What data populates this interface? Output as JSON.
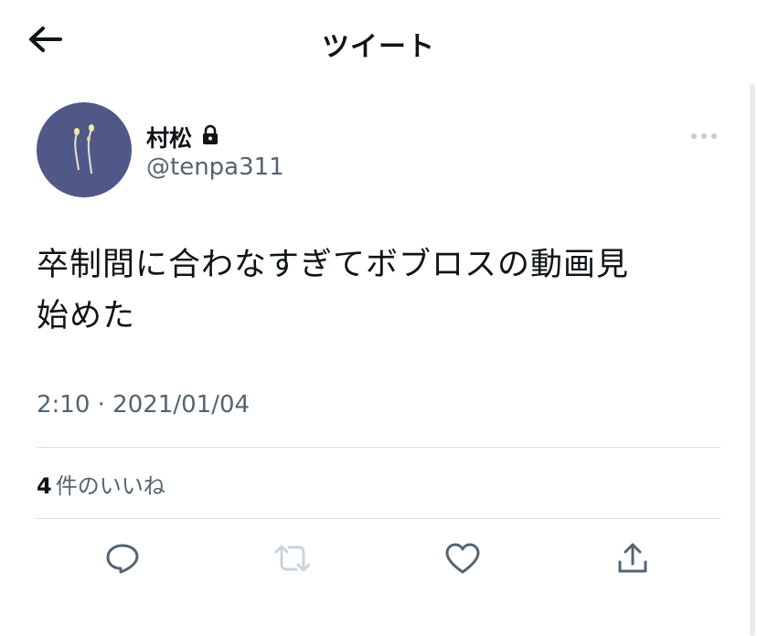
{
  "header": {
    "title": "ツイート",
    "back_icon": "arrow-left-icon"
  },
  "tweet": {
    "author": {
      "display_name": "村松",
      "handle": "@tenpa311",
      "protected_icon": "lock-icon",
      "avatar_color": "#4f5887"
    },
    "text_lines": [
      "卒制間に合わなすぎてボブロスの動画見",
      "始めた"
    ],
    "timestamp": "2:10 · 2021/01/04",
    "likes": {
      "count": "4",
      "label": "件のいいね"
    }
  },
  "actions": {
    "reply_icon": "reply-bubble-icon",
    "retweet_icon": "retweet-icon",
    "like_icon": "heart-icon",
    "share_icon": "share-icon",
    "retweet_disabled": true
  },
  "colors": {
    "text_primary": "#0f1419",
    "text_secondary": "#536471",
    "divider": "#dadde0",
    "retweet_disabled": "#c9d3dc"
  }
}
